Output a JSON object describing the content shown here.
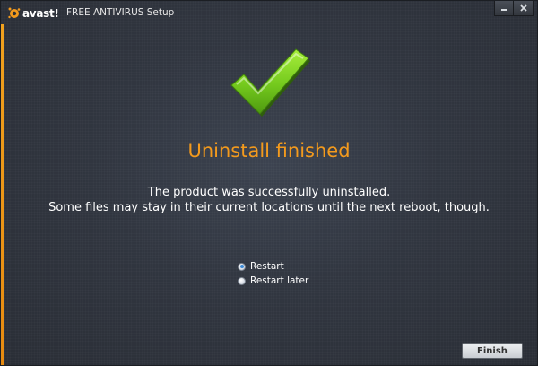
{
  "window": {
    "logo_text": "avast!",
    "title": "FREE ANTIVIRUS Setup",
    "controls": {
      "minimize_icon": "minimize-icon",
      "close_icon": "close-icon"
    }
  },
  "main": {
    "status_icon": "checkmark-icon",
    "headline": "Uninstall finished",
    "message_line1": "The product was successfully uninstalled.",
    "message_line2": "Some files may stay in their current locations until the next reboot, though."
  },
  "restart_options": {
    "selected": "Restart",
    "options": [
      {
        "label": "Restart",
        "checked": true
      },
      {
        "label": "Restart later",
        "checked": false
      }
    ]
  },
  "footer": {
    "finish_label": "Finish"
  },
  "colors": {
    "accent": "#f39a1d",
    "check_green": "#7ed321",
    "background": "#313640"
  }
}
